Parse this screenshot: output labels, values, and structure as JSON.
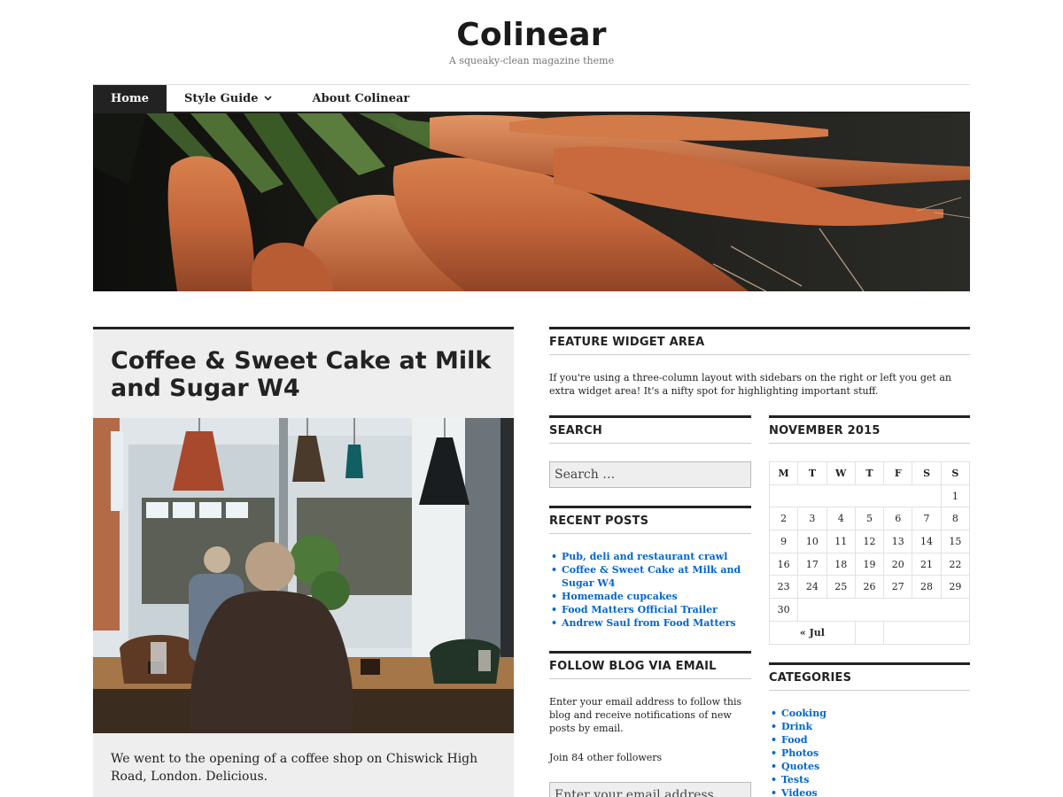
{
  "site": {
    "title": "Colinear",
    "tagline": "A squeaky-clean magazine theme"
  },
  "nav": {
    "items": [
      "Home",
      "Style Guide",
      "About Colinear"
    ]
  },
  "post": {
    "title": "Coffee & Sweet Cake at Milk and Sugar W4",
    "excerpt": "We went to the opening of a coffee shop on Chiswick High Road, London. Delicious."
  },
  "feature_widget": {
    "title": "FEATURE WIDGET AREA",
    "text": "If you're using a three-column layout with sidebars on the right or left you get an extra widget area! It's a nifty spot for highlighting important stuff."
  },
  "search_widget": {
    "title": "SEARCH",
    "placeholder": "Search …"
  },
  "recent_posts": {
    "title": "RECENT POSTS",
    "items": [
      "Pub, deli and restaurant crawl",
      "Coffee & Sweet Cake at Milk and Sugar W4",
      "Homemade cupcakes",
      "Food Matters Official Trailer",
      "Andrew Saul from Food Matters"
    ]
  },
  "follow_widget": {
    "title": "FOLLOW BLOG VIA EMAIL",
    "text": "Enter your email address to follow this blog and receive notifications of new posts by email.",
    "followers": "Join 84 other followers",
    "placeholder": "Enter your email address"
  },
  "calendar": {
    "title": "NOVEMBER 2015",
    "weekdays": [
      "M",
      "T",
      "W",
      "T",
      "F",
      "S",
      "S"
    ],
    "weeks": [
      [
        "",
        "",
        "",
        "",
        "",
        "",
        "1"
      ],
      [
        "2",
        "3",
        "4",
        "5",
        "6",
        "7",
        "8"
      ],
      [
        "9",
        "10",
        "11",
        "12",
        "13",
        "14",
        "15"
      ],
      [
        "16",
        "17",
        "18",
        "19",
        "20",
        "21",
        "22"
      ],
      [
        "23",
        "24",
        "25",
        "26",
        "27",
        "28",
        "29"
      ],
      [
        "30",
        "",
        "",
        "",
        "",
        "",
        ""
      ]
    ],
    "prev_link": "« Jul"
  },
  "categories": {
    "title": "CATEGORIES",
    "items": [
      "Cooking",
      "Drink",
      "Food",
      "Photos",
      "Quotes",
      "Tests",
      "Videos"
    ]
  },
  "colors": {
    "link": "#0066cc",
    "dark": "#222222",
    "panel": "#eeeeee"
  },
  "icons": {
    "dropdown": "chevron-down-icon"
  }
}
